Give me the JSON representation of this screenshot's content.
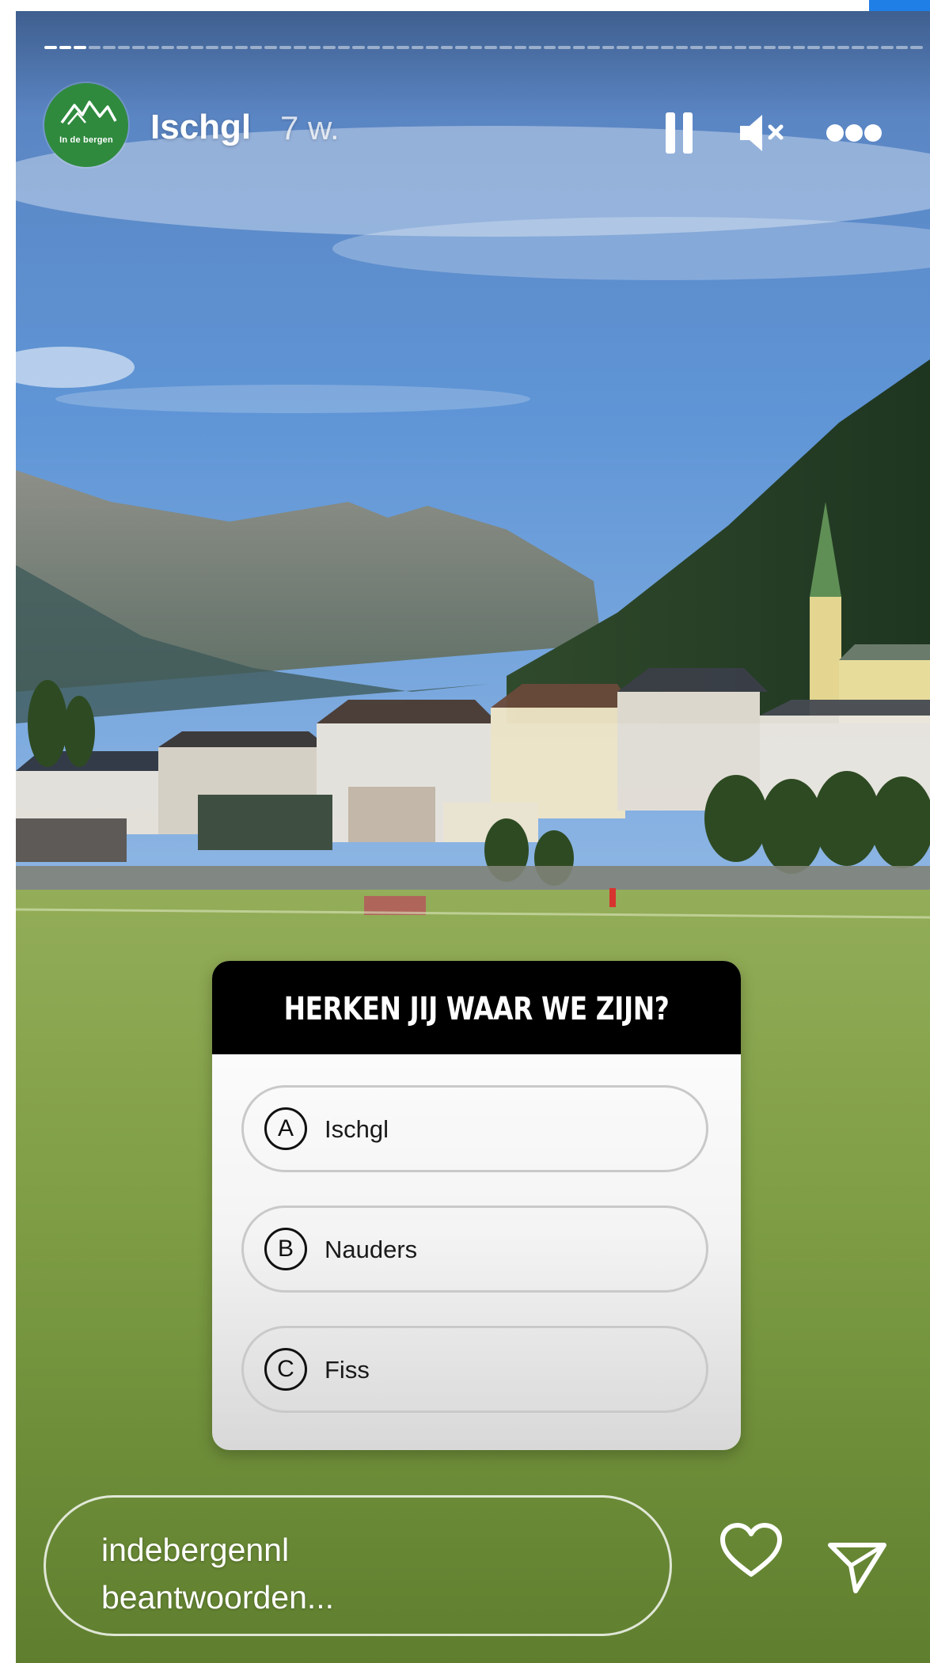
{
  "story": {
    "progress": {
      "total_segments": 60,
      "current_segment": 3
    },
    "account": {
      "avatar_text": "In de bergen",
      "location": "Ischgl",
      "age": "7 w."
    },
    "controls": {
      "pause_icon": "pause-icon",
      "mute_icon": "speaker-muted-icon",
      "more_icon": "more-horizontal-icon"
    },
    "quiz": {
      "question": "HERKEN JIJ WAAR WE ZIJN?",
      "options": [
        {
          "letter": "A",
          "label": "Ischgl"
        },
        {
          "letter": "B",
          "label": "Nauders"
        },
        {
          "letter": "C",
          "label": "Fiss"
        }
      ]
    },
    "reply": {
      "placeholder_line1": "indebergennl",
      "placeholder_line2": "beantwoorden..."
    },
    "actions": {
      "like_icon": "heart-icon",
      "share_icon": "send-icon"
    },
    "colors": {
      "avatar_green": "#2f8a3e",
      "quiz_header": "#000000",
      "sky": "#5a8fd0",
      "meadow": "#7fa048"
    }
  }
}
